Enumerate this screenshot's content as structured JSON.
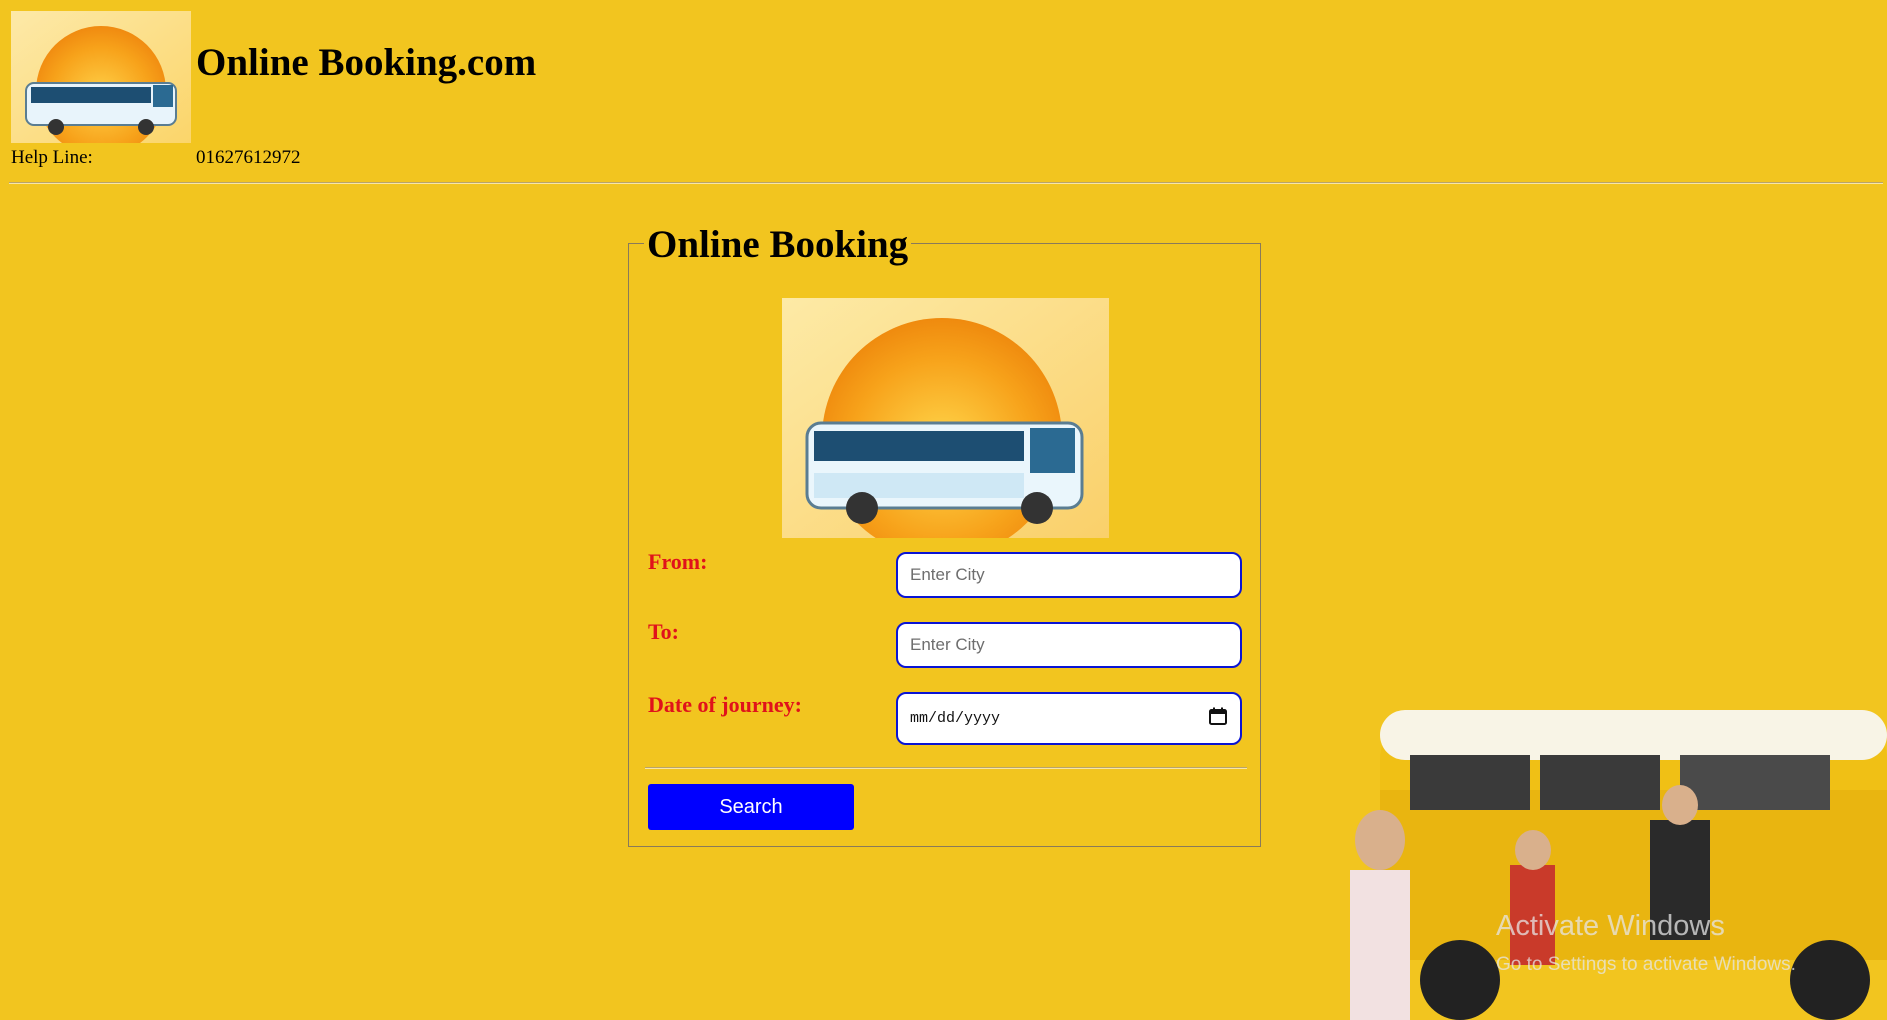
{
  "header": {
    "site_title": "Online Booking.com",
    "helpline_label": "Help Line:",
    "helpline_number": "01627612972"
  },
  "booking": {
    "legend": "Online Booking",
    "from_label": "From:",
    "from_placeholder": "Enter City",
    "to_label": "To:",
    "to_placeholder": "Enter City",
    "date_label": "Date of journey:",
    "date_placeholder": "mm/dd/yyyy",
    "search_label": "Search"
  },
  "os_watermark": {
    "title": "Activate Windows",
    "subtitle": "Go to Settings to activate Windows."
  },
  "icons": {
    "calendar": "calendar-icon"
  },
  "colors": {
    "background": "#f2c51f",
    "label_red": "#e0121b",
    "input_border": "#0a14d4",
    "button_blue": "#0000ff"
  }
}
